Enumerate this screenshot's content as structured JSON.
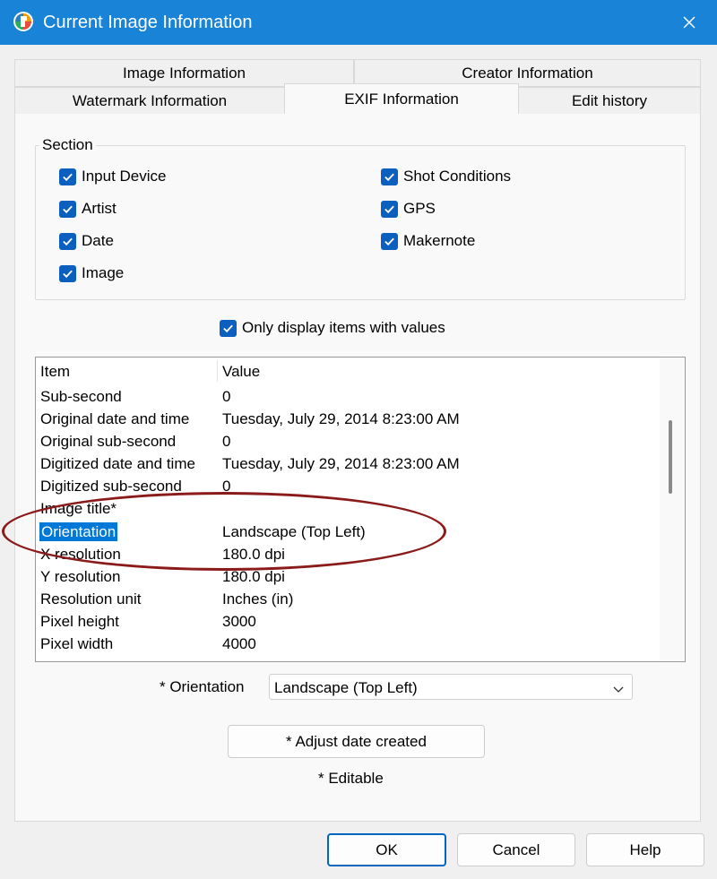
{
  "window": {
    "title": "Current Image Information",
    "close_icon": "close-icon",
    "app_icon": "app-logo-icon"
  },
  "tabs": {
    "row1": [
      "Image Information",
      "Creator Information"
    ],
    "row2": [
      "Watermark Information",
      "EXIF Information",
      "Edit history"
    ],
    "active": "EXIF Information"
  },
  "section": {
    "label": "Section",
    "checkboxes": [
      {
        "label": "Input Device",
        "checked": true
      },
      {
        "label": "Artist",
        "checked": true
      },
      {
        "label": "Date",
        "checked": true
      },
      {
        "label": "Image",
        "checked": true
      },
      {
        "label": "Shot Conditions",
        "checked": true
      },
      {
        "label": "GPS",
        "checked": true
      },
      {
        "label": "Makernote",
        "checked": true
      }
    ]
  },
  "only_values": {
    "label": "Only display items with values",
    "checked": true
  },
  "table": {
    "columns": [
      "Item",
      "Value"
    ],
    "rows": [
      {
        "item": "Sub-second",
        "value": "0"
      },
      {
        "item": "Original date and time",
        "value": "Tuesday, July 29, 2014 8:23:00 AM"
      },
      {
        "item": "Original sub-second",
        "value": "0"
      },
      {
        "item": "Digitized date and time",
        "value": "Tuesday, July 29, 2014 8:23:00 AM"
      },
      {
        "item": "Digitized sub-second",
        "value": "0"
      },
      {
        "item": "Image title*",
        "value": ""
      },
      {
        "item": "Orientation",
        "value": "Landscape (Top Left)",
        "selected": true
      },
      {
        "item": "X resolution",
        "value": "180.0 dpi"
      },
      {
        "item": "Y resolution",
        "value": "180.0 dpi"
      },
      {
        "item": "Resolution unit",
        "value": "Inches (in)"
      },
      {
        "item": "Pixel height",
        "value": "3000"
      },
      {
        "item": "Pixel width",
        "value": "4000"
      }
    ]
  },
  "orientation": {
    "label": "* Orientation",
    "value": "Landscape (Top Left)"
  },
  "adjust_button": "* Adjust date created",
  "editable_note": "* Editable",
  "footer": {
    "ok": "OK",
    "cancel": "Cancel",
    "help": "Help"
  },
  "colors": {
    "titlebar": "#1883d7",
    "checkbox": "#0a5fbf",
    "selection": "#0078d7",
    "annotation": "#8b1a1a"
  }
}
